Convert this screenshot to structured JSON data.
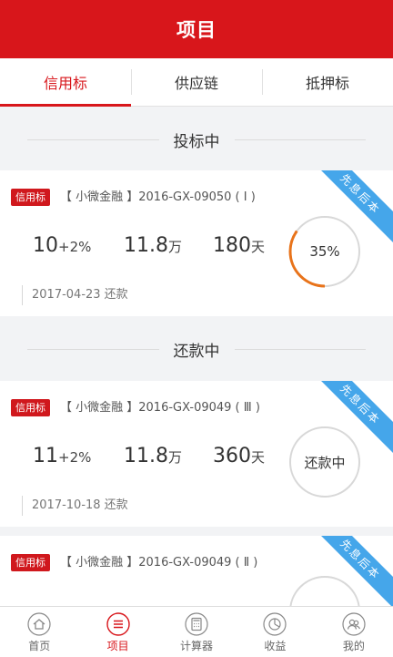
{
  "header": {
    "title": "项目"
  },
  "tabs": [
    {
      "label": "信用标",
      "active": true
    },
    {
      "label": "供应链",
      "active": false
    },
    {
      "label": "抵押标",
      "active": false
    }
  ],
  "sections": [
    {
      "title": "投标中"
    },
    {
      "title": "还款中"
    }
  ],
  "cards": [
    {
      "badge": "信用标",
      "product": "【 小微金融 】2016-GX-09050 ( Ⅰ )",
      "corner": "先息后本",
      "rate_base": "10",
      "rate_bonus": "+2%",
      "amount": "11.8",
      "amount_unit": "万",
      "term": "180",
      "term_unit": "天",
      "ring_label": "35%",
      "progress": 0.35,
      "date": "2017-04-23 还款"
    },
    {
      "badge": "信用标",
      "product": "【 小微金融 】2016-GX-09049 ( Ⅲ )",
      "corner": "先息后本",
      "rate_base": "11",
      "rate_bonus": "+2%",
      "amount": "11.8",
      "amount_unit": "万",
      "term": "360",
      "term_unit": "天",
      "ring_label": "还款中",
      "progress": 0,
      "date": "2017-10-18 还款"
    },
    {
      "badge": "信用标",
      "product": "【 小微金融 】2016-GX-09049 ( Ⅱ )",
      "corner": "先息后本",
      "rate_base": "",
      "rate_bonus": "",
      "amount": "",
      "amount_unit": "",
      "term": "",
      "term_unit": "",
      "ring_label": "",
      "progress": 0,
      "date": ""
    }
  ],
  "colors": {
    "brand": "#d8161b",
    "progress": "#e8731a",
    "corner": "#45a6ea"
  },
  "nav": [
    {
      "label": "首页",
      "icon": "home-icon",
      "active": false
    },
    {
      "label": "项目",
      "icon": "list-icon",
      "active": true
    },
    {
      "label": "计算器",
      "icon": "calculator-icon",
      "active": false
    },
    {
      "label": "收益",
      "icon": "pie-chart-icon",
      "active": false
    },
    {
      "label": "我的",
      "icon": "user-icon",
      "active": false
    }
  ]
}
